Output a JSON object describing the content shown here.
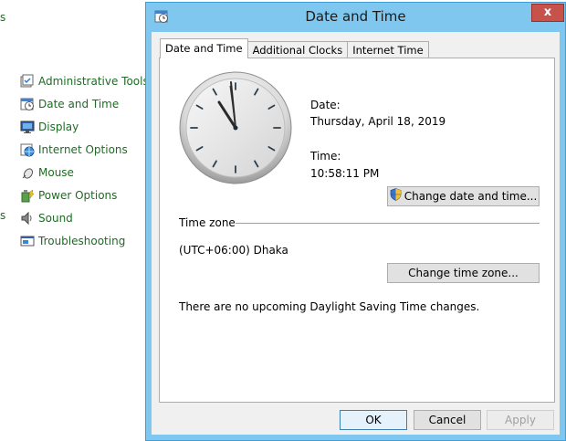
{
  "background": {
    "edge_fragment_top": "s",
    "edge_fragment_sound": "s",
    "items": [
      {
        "label": "Administrative Tools",
        "icon": "administrative-tools-icon"
      },
      {
        "label": "Date and Time",
        "icon": "date-time-icon"
      },
      {
        "label": "Display",
        "icon": "display-icon"
      },
      {
        "label": "Internet Options",
        "icon": "internet-options-icon"
      },
      {
        "label": "Mouse",
        "icon": "mouse-icon"
      },
      {
        "label": "Power Options",
        "icon": "power-options-icon"
      },
      {
        "label": "Sound",
        "icon": "sound-icon"
      },
      {
        "label": "Troubleshooting",
        "icon": "troubleshooting-icon"
      }
    ]
  },
  "dialog": {
    "title": "Date and Time",
    "close_label": "x",
    "tabs": [
      {
        "label": "Date and Time",
        "active": true
      },
      {
        "label": "Additional Clocks",
        "active": false
      },
      {
        "label": "Internet Time",
        "active": false
      }
    ],
    "date_label": "Date:",
    "date_value": "Thursday, April 18, 2019",
    "time_label": "Time:",
    "time_value": "10:58:11 PM",
    "change_datetime_label": "Change date and time...",
    "timezone_group_label": "Time zone",
    "timezone_value": "(UTC+06:00) Dhaka",
    "change_timezone_label": "Change time zone...",
    "dst_message": "There are no upcoming Daylight Saving Time changes.",
    "ok_label": "OK",
    "cancel_label": "Cancel",
    "apply_label": "Apply"
  },
  "colors": {
    "link_green": "#1e6b24",
    "title_bar": "#7fc7ef",
    "close_red": "#c7514b"
  }
}
